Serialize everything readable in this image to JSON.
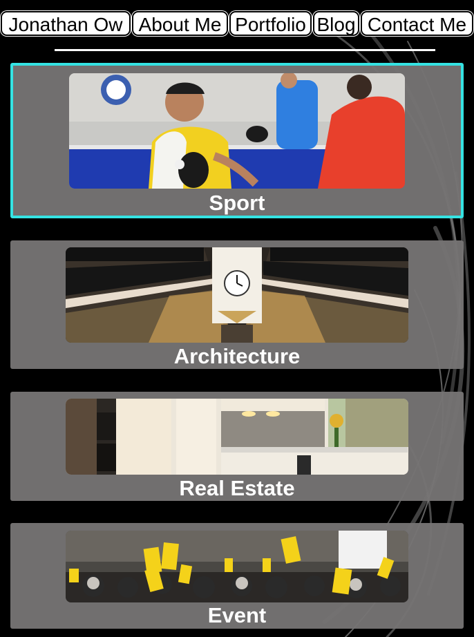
{
  "nav": {
    "items": [
      {
        "label": "Jonathan Ow"
      },
      {
        "label": "About Me"
      },
      {
        "label": "Portfolio"
      },
      {
        "label": "Blog"
      },
      {
        "label": "Contact Me"
      }
    ]
  },
  "gallery": {
    "categories": [
      {
        "label": "Sport",
        "selected": true,
        "photo": "table-tennis-player-photo"
      },
      {
        "label": "Architecture",
        "selected": false,
        "photo": "shopping-arcade-interior-photo"
      },
      {
        "label": "Real Estate",
        "selected": false,
        "photo": "kitchen-interior-photo"
      },
      {
        "label": "Event",
        "selected": false,
        "photo": "audience-voting-cards-photo"
      }
    ]
  },
  "colors": {
    "background": "#000000",
    "card": "#767474",
    "selected_border": "#35e3e3",
    "text": "#ffffff"
  }
}
